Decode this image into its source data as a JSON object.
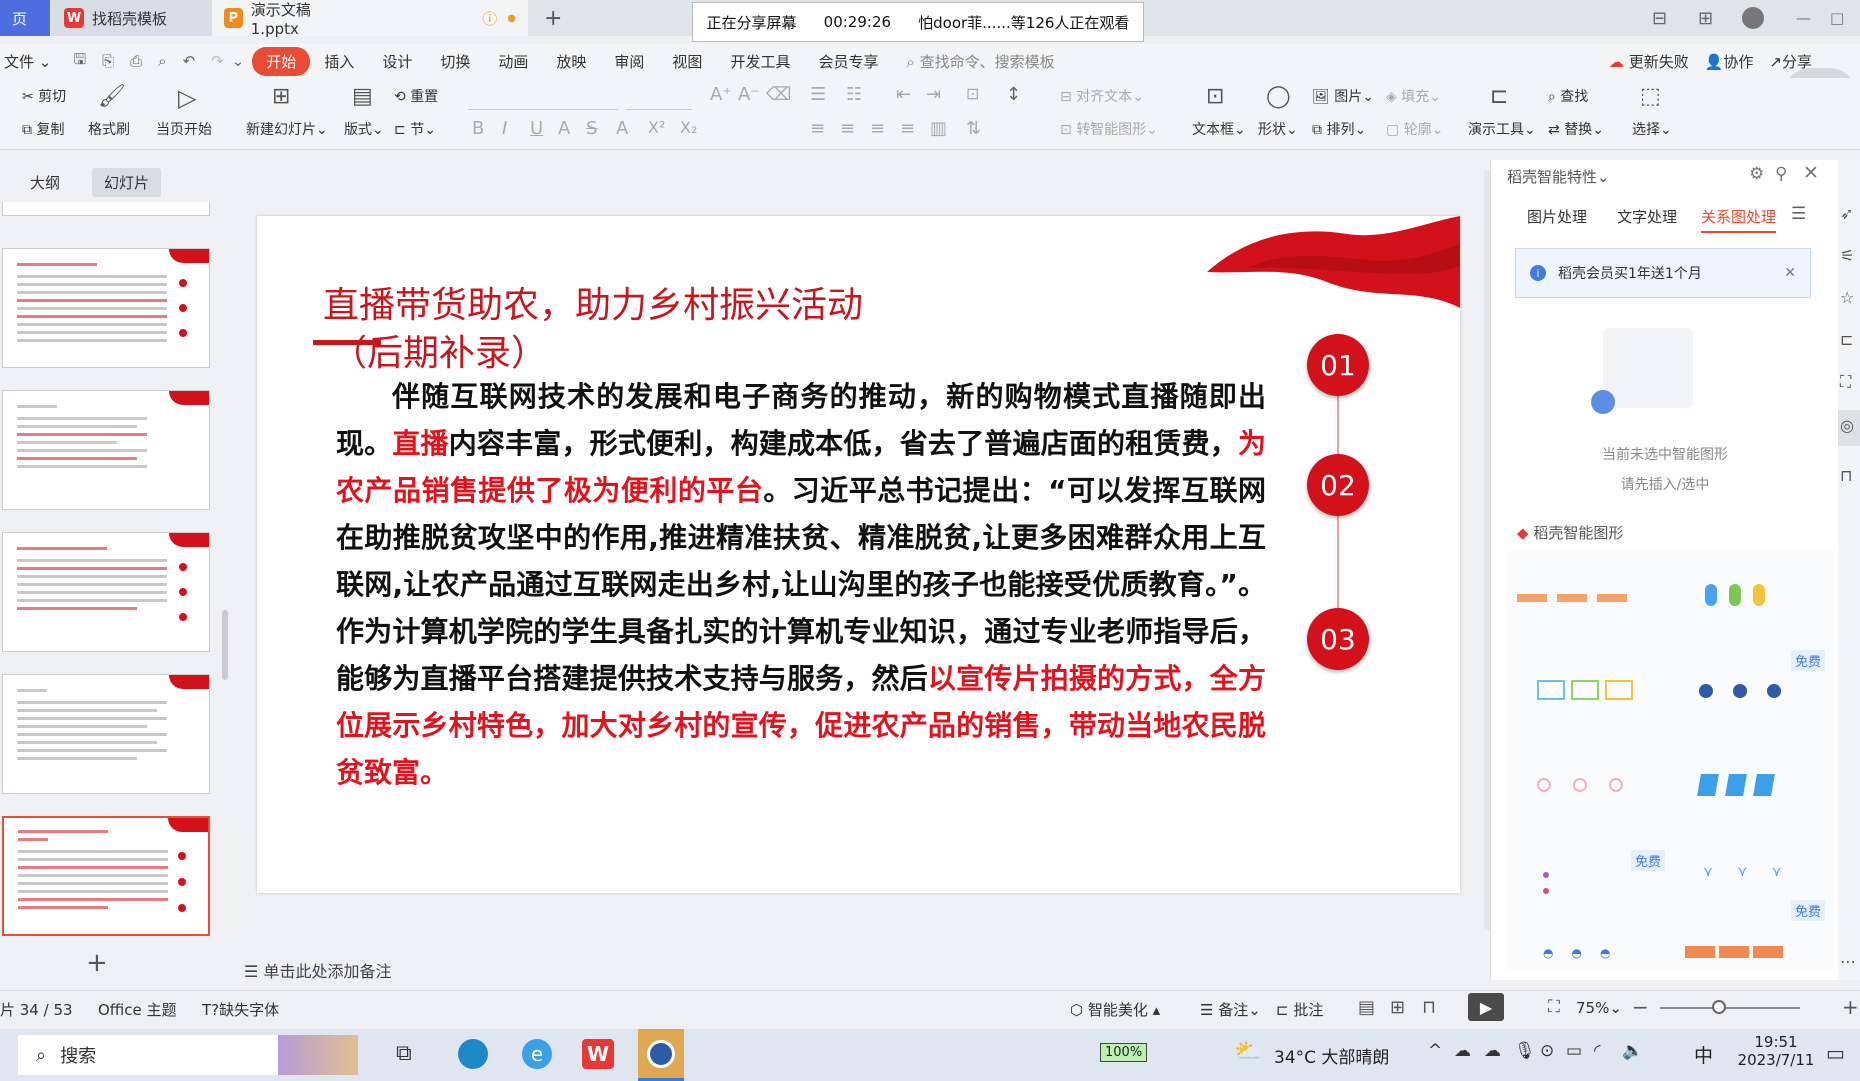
{
  "tabs": {
    "home": "页",
    "template": "找稻壳模板",
    "doc": "演示文稿1.pptx"
  },
  "share_bar": {
    "status": "正在分享屏幕",
    "time": "00:29:26",
    "viewers": "怕door菲......等126人正在观看"
  },
  "menu": {
    "file": "文件",
    "items": [
      "开始",
      "插入",
      "设计",
      "切换",
      "动画",
      "放映",
      "审阅",
      "视图",
      "开发工具",
      "会员专享"
    ],
    "search": "查找命令、搜索模板",
    "update": "更新失败",
    "collab": "协作",
    "share": "分享"
  },
  "toolbar": {
    "cut": "剪切",
    "copy": "复制",
    "format_brush": "格式刷",
    "from_current": "当页开始",
    "new_slide": "新建幻灯片",
    "layout": "版式",
    "reset": "重置",
    "section": "节",
    "align_text": "对齐文本",
    "convert_smart": "转智能图形",
    "textbox": "文本框",
    "shape": "形状",
    "picture": "图片",
    "arrange": "排列",
    "fill": "填充",
    "outline": "轮廓",
    "present_tools": "演示工具",
    "find": "查找",
    "replace": "替换",
    "select": "选择"
  },
  "left_panel": {
    "tab_outline": "大纲",
    "tab_slides": "幻灯片"
  },
  "slide": {
    "title_line1": "直播带货助农，助力乡村振兴活动",
    "title_line2": "（后期补录）",
    "body": [
      {
        "t": "伴随互联网技术的发展和电子商务的推动，新的购物模式直播随即出现。",
        "red": false
      },
      {
        "t": "直播",
        "red": true
      },
      {
        "t": "内容丰富，形式便利，构建成本低，省去了普遍店面的租赁费，",
        "red": false
      },
      {
        "t": "为农产品销售提供了极为便利的平台",
        "red": true
      },
      {
        "t": "。习近平总书记提出：“可以发挥互联网在助推脱贫攻坚中的作用,推进精准扶贫、精准脱贫,让更多困难群众用上互联网,让农产品通过互联网走出乡村,让山沟里的孩子也能接受优质教育。”。作为计算机学院的学生具备扎实的计算机专业知识，通过专业老师指导后，能够为直播平台搭建提供技术支持与服务，然后",
        "red": false
      },
      {
        "t": "以宣传片拍摄的方式，全方位展示乡村特色，加大对乡村的宣传，促进农产品的销售，带动当地农民脱贫致富",
        "red": true
      },
      {
        "t": "。",
        "red": false
      }
    ],
    "numbers": [
      "01",
      "02",
      "03"
    ]
  },
  "right_panel": {
    "title": "稻壳智能特性",
    "tabs": [
      "图片处理",
      "文字处理",
      "关系图处理"
    ],
    "promo": "稻壳会员买1年送1个月",
    "empty_line1": "当前未选中智能图形",
    "empty_line2": "请先插入/选中",
    "section": "稻壳智能图形",
    "free": "免费"
  },
  "notes": "单击此处添加备注",
  "status": {
    "slide": "片 34 / 53",
    "theme": "Office 主题",
    "missing_font": "缺失字体",
    "beautify": "智能美化",
    "notes": "备注",
    "comment": "批注",
    "zoom": "75%"
  },
  "taskbar": {
    "search": "搜索",
    "battery": "100%",
    "weather": "34°C 大部晴朗",
    "ime": "中",
    "time": "19:51",
    "date": "2023/7/11"
  }
}
